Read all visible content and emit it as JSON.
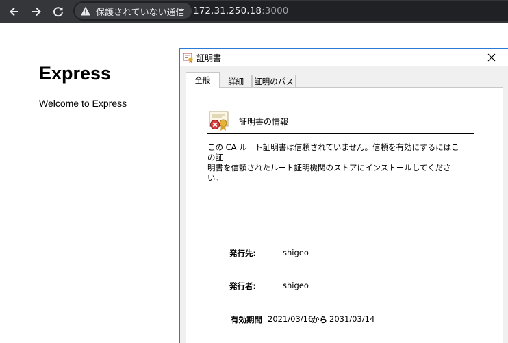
{
  "browser": {
    "security_text": "保護されていない通信",
    "url_host": "172.31.250.18",
    "url_port": ":3000"
  },
  "page": {
    "heading": "Express",
    "text": "Welcome to Express"
  },
  "dialog": {
    "title": "証明書",
    "tabs": [
      {
        "label": "全般",
        "active": true
      },
      {
        "label": "詳細",
        "active": false
      },
      {
        "label": "証明のパス",
        "active": false
      }
    ],
    "info_title": "証明書の情報",
    "warning_line1": "この CA ルート証明書は信頼されていません。信頼を有効にするにはこの証",
    "warning_line2": "明書を信頼されたルート証明機関のストアにインストールしてください。",
    "issued_to_label": "発行先:",
    "issued_to_value": "shigeo",
    "issued_by_label": "発行者:",
    "issued_by_value": "shigeo",
    "validity_label": "有効期間",
    "valid_from": "2021/03/16",
    "validity_sep": "から",
    "valid_to": "2031/03/14"
  },
  "icons": {
    "back": "arrow-left-icon",
    "forward": "arrow-right-icon",
    "reload": "reload-icon",
    "warning": "warning-triangle-icon",
    "close": "close-icon",
    "certificate": "certificate-error-icon"
  },
  "colors": {
    "toolbar": "#35363a",
    "omnibox": "#202124",
    "dialog_border": "#2b7bd4"
  }
}
